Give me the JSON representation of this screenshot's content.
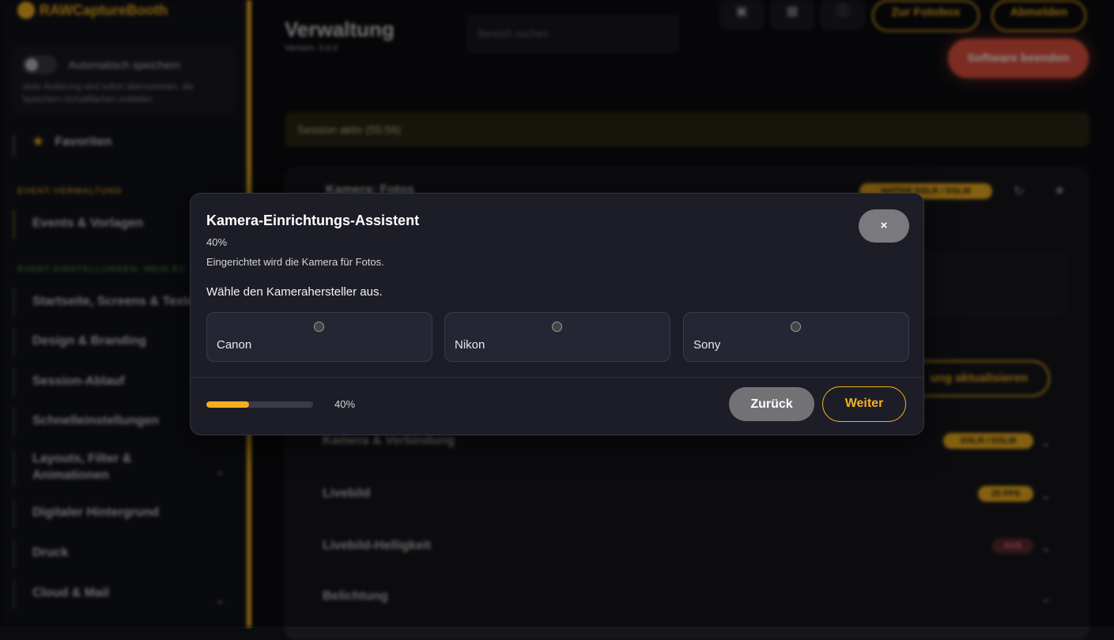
{
  "app": {
    "logo": "RAWCaptureBooth",
    "autosave": {
      "label": "Automatisch speichern",
      "hint": "Jede Änderung wird sofort übernommen, die Speichern-Schaltflächen entfallen."
    },
    "sidebar": {
      "favorites": "Favoriten",
      "section_event_admin": "EVENT-VERWALTUNG",
      "events_templates": "Events & Vorlagen",
      "section_event_settings": "EVENT-EINSTELLUNGEN: MEIN EV",
      "items": [
        "Startseite, Screens & Texte",
        "Design & Branding",
        "Session-Ablauf",
        "Schnelleinstellungen",
        "Layouts, Filter & Animationen",
        "Digitaler Hintergrund",
        "Druck",
        "Cloud & Mail"
      ]
    },
    "header": {
      "title": "Verwaltung",
      "version": "Version: 3.0.0",
      "search_placeholder": "Bereich suchen",
      "to_photobox": "Zur Fotobox",
      "logout": "Abmelden",
      "quit": "Software beenden"
    },
    "session_banner": "Session aktiv (55:59)",
    "panel": {
      "title": "Kamera: Fotos",
      "badge": "NATIVE DSLR / DSLM",
      "update_button": "ung aktualisieren",
      "rows": [
        {
          "label": "Kamera & Verbindung",
          "badge": "DSLR / DSLM"
        },
        {
          "label": "Livebild",
          "badge": "25 FPS"
        },
        {
          "label": "Livebild-Helligkeit",
          "badge": "AUS"
        },
        {
          "label": "Belichtung",
          "badge": ""
        }
      ]
    }
  },
  "modal": {
    "title": "Kamera-Einrichtungs-Assistent",
    "progress_label": "40%",
    "subtitle": "Eingerichtet wird die Kamera für Fotos.",
    "question": "Wähle den Kamerahersteller aus.",
    "options": [
      "Canon",
      "Nikon",
      "Sony"
    ],
    "close_label": "×",
    "progress": 0.4,
    "progress_text": "40%",
    "back_label": "Zurück",
    "next_label": "Weiter"
  },
  "colors": {
    "accent": "#f2b01e",
    "danger": "#e2513f",
    "modal_bg": "#1c1d27"
  }
}
